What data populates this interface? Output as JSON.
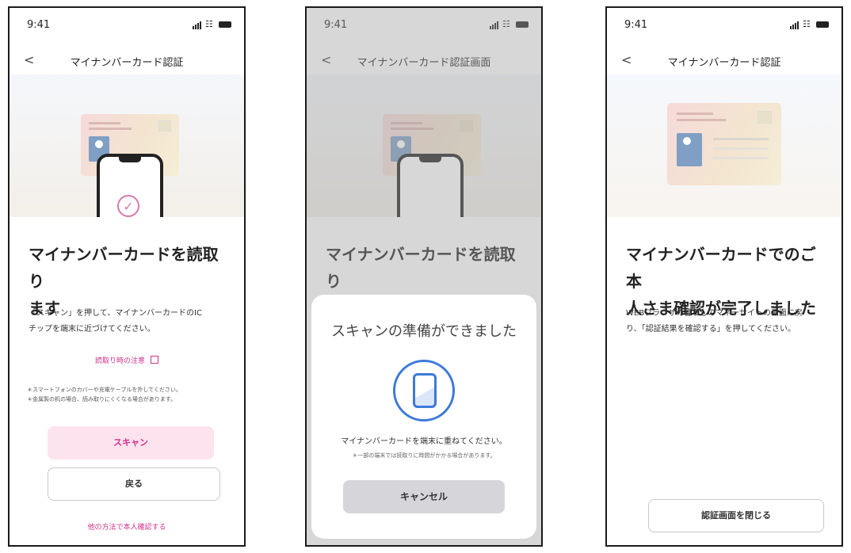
{
  "screens": [
    {
      "status": {
        "time": "9:41"
      },
      "nav": {
        "back": "<",
        "title": "マイナンバーカード認証"
      },
      "title_lines": [
        "マイナンバーカードを読取り",
        "ます"
      ],
      "body_lines": [
        "「スキャン」を押して、マイナンバーカードのIC",
        "チップを端末に近づけてください。"
      ],
      "link": "読取り時の注意",
      "notes": [
        "＊スマートフォンのカバーや充電ケーブルを外してください。",
        "＊金属製の机の場合、読み取りにくくなる場合があります。"
      ],
      "buttons": {
        "scan": "スキャン",
        "back": "戻る"
      },
      "bottom_link": "他の方法で本人確認する"
    },
    {
      "status": {
        "time": "9:41"
      },
      "nav": {
        "back": "<",
        "title": "マイナンバーカード認証画面"
      },
      "title_lines": [
        "マイナンバーカードを読取り",
        "ます"
      ],
      "sheet": {
        "title": "スキャンの準備ができました",
        "instruction": "マイナンバーカードを端末に重ねてください。",
        "note": "＊一部の端末では読取りに時間がかかる場合があります。",
        "cancel": "キャンセル"
      }
    },
    {
      "status": {
        "time": "9:41"
      },
      "nav": {
        "back": "<",
        "title": "マイナンバーカード認証"
      },
      "title_lines": [
        "マイナンバーカードでのご本",
        "人さま確認が完了しました"
      ],
      "body_lines": [
        "WEBブラウザの暮らしのマネーサイトの画面に戻",
        "り、「認証結果を確認する」を押してください。"
      ],
      "close_button": "認証画面を閉じる"
    }
  ],
  "colors": {
    "accent_pink": "#d1308c",
    "scan_blue": "#3d7ad8"
  },
  "icons": [
    "back-chevron-icon",
    "signal-icon",
    "wifi-icon",
    "battery-icon",
    "external-link-icon",
    "check-circle-icon",
    "phone-scan-icon"
  ]
}
